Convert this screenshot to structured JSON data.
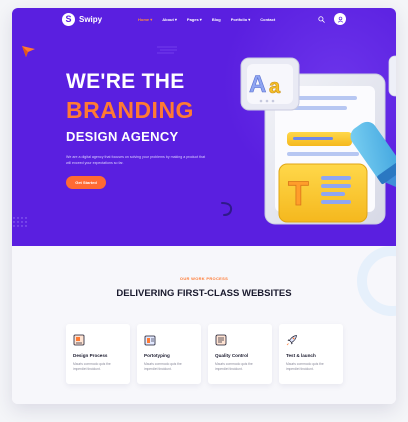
{
  "brand": {
    "name": "Swipy",
    "mark": "S"
  },
  "nav": {
    "items": [
      {
        "label": "Home ▾",
        "active": true
      },
      {
        "label": "About ▾",
        "active": false
      },
      {
        "label": "Pages ▾",
        "active": false
      },
      {
        "label": "Blog",
        "active": false
      },
      {
        "label": "Portfolio ▾",
        "active": false
      },
      {
        "label": "Contact",
        "active": false
      }
    ],
    "search_icon": "search-icon",
    "user_icon": "user-icon"
  },
  "hero": {
    "line1": "WE'RE THE",
    "line2": "BRANDING",
    "line3": "DESIGN AGENCY",
    "intro": "We are a digital agency that focuses on solving your problems by making a product that will exceed your expectations so far.",
    "cta_label": "Get Started",
    "illustration": {
      "glyph_a_large": "A",
      "glyph_a_small": "a",
      "glyph_t": "T"
    }
  },
  "process": {
    "eyebrow": "OUR WORK PROCESS",
    "title": "DELIVERING FIRST-CLASS WEBSITES",
    "cards": [
      {
        "title": "Design Process",
        "desc": "Mauris commodo quis the imperdiet tincidunt.",
        "icon": "design-process-icon"
      },
      {
        "title": "Portotyping",
        "desc": "Mauris commodo quis the imperdiet tincidunt.",
        "icon": "prototyping-icon"
      },
      {
        "title": "Quality Control",
        "desc": "Mauris commodo quis the imperdiet tincidunt.",
        "icon": "quality-control-icon"
      },
      {
        "title": "Test & launch",
        "desc": "Mauris commodo quis the imperdiet tincidunt.",
        "icon": "rocket-icon"
      }
    ]
  },
  "colors": {
    "hero_bg": "#5a1fe0",
    "accent": "#ff7a33",
    "dark_text": "#1a1a2e"
  }
}
